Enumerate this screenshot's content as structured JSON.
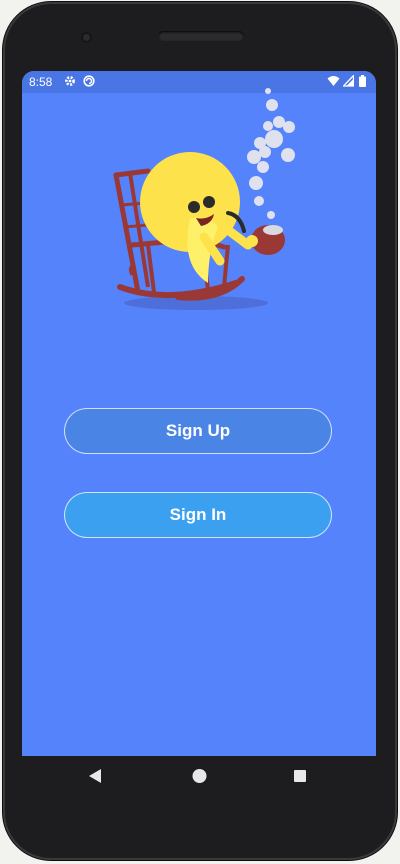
{
  "status_bar": {
    "time": "8:58",
    "icons": [
      "settings-icon",
      "sync-icon",
      "wifi-icon",
      "signal-icon",
      "battery-icon"
    ]
  },
  "illustration": {
    "description_icon": "character-smoking-pipe-rocking-chair-icon"
  },
  "buttons": {
    "sign_up": "Sign Up",
    "sign_in": "Sign In"
  },
  "nav_bar": {
    "icons": [
      "back-icon",
      "home-icon",
      "recents-icon"
    ]
  },
  "colors": {
    "background": "#5583fb",
    "status_bar": "#4a76e5",
    "sign_up_button": "#4a85e6",
    "sign_in_button": "#3ca0f0"
  }
}
